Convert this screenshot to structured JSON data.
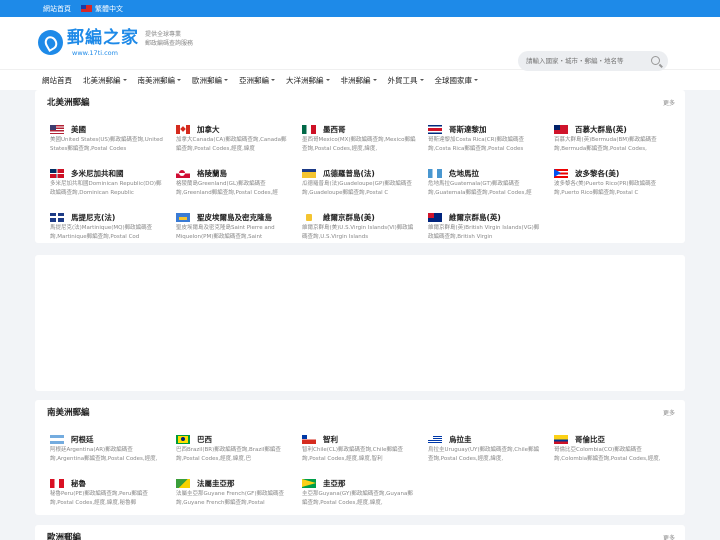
{
  "topbar": {
    "home": "網站首頁",
    "lang": "繁體中文"
  },
  "header": {
    "logo_name": "郵編之家",
    "logo_url": "www.17ti.com",
    "slogan_1": "提供全球專業",
    "slogan_2": "郵政編碼查詢服務",
    "search_placeholder": "請輸入國家・城市・郵編・地名等"
  },
  "nav": [
    "網站首頁",
    "北美洲郵編",
    "南美洲郵編",
    "歐洲郵編",
    "亞洲郵編",
    "大洋洲郵編",
    "非洲郵編",
    "外貿工具",
    "全球國家庫"
  ],
  "sections": [
    {
      "title": "北美洲郵編",
      "more": "更多",
      "items": [
        {
          "name": "美國",
          "flag": "us",
          "desc": "美國United States(US)郵政編碼查詢,United States郵編查詢,Postal Codes"
        },
        {
          "name": "加拿大",
          "flag": "ca",
          "desc": "加拿大Canada(CA)郵政編碼查詢,Canada郵編查詢,Postal Codes,經度,緯度"
        },
        {
          "name": "墨西哥",
          "flag": "mx",
          "desc": "墨西哥Mexico(MX)郵政編碼查詢,Mexico郵編查詢,Postal Codes,經度,緯度,"
        },
        {
          "name": "哥斯達黎加",
          "flag": "cr",
          "desc": "哥斯達黎加Costa Rica(CR)郵政編碼查詢,Costa Rica郵編查詢,Postal Codes"
        },
        {
          "name": "百慕大群島(英)",
          "flag": "bm",
          "desc": "百慕大群島(英)Bermuda(BM)郵政編碼查詢,Bermuda郵編查詢,Postal Codes,"
        },
        {
          "name": "多米尼加共和國",
          "flag": "do",
          "desc": "多米尼加共和國Dominican Republic(DO)郵政編碼查詢,Dominican Republic"
        },
        {
          "name": "格陵蘭島",
          "flag": "gl",
          "desc": "格陵蘭島Greenland(GL)郵政編碼查詢,Greenland郵編查詢,Postal Codes,經"
        },
        {
          "name": "瓜德羅普島(法)",
          "flag": "gp",
          "desc": "瓜德羅普島(法)Guadeloupe(GP)郵政編碼查詢,Guadeloupe郵編查詢,Postal C"
        },
        {
          "name": "危地馬拉",
          "flag": "gt",
          "desc": "危地馬拉Guatemala(GT)郵政編碼查詢,Guatemala郵編查詢,Postal Codes,經"
        },
        {
          "name": "波多黎各(美)",
          "flag": "pr",
          "desc": "波多黎各(美)Puerto Rico(PR)郵政編碼查詢,Puerto Rico郵編查詢,Postal C"
        },
        {
          "name": "馬提尼克(法)",
          "flag": "mq",
          "desc": "馬提尼克(法)Martinique(MQ)郵政編碼查詢,Martinique郵編查詢,Postal Cod"
        },
        {
          "name": "聖皮埃爾島及密克隆島",
          "flag": "pm",
          "desc": "聖皮埃爾島及密克隆島Saint Pierre and Miquelon(PM)郵政編碼查詢,Saint"
        },
        {
          "name": "維爾京群島(美)",
          "flag": "vi",
          "desc": "維爾京群島(美)U.S.Virgin Islands(VI)郵政編碼查詢,U.S.Virgin Islands"
        },
        {
          "name": "維爾京群島(英)",
          "flag": "vg",
          "desc": "維爾京群島(英)British Virgin Islands(VG)郵政編碼查詢,British Virgin"
        }
      ]
    },
    {
      "title": "南美洲郵編",
      "more": "更多",
      "items": [
        {
          "name": "阿根廷",
          "flag": "ar",
          "desc": "阿根廷Argentina(AR)郵政編碼查詢,Argentina郵編查詢,Postal Codes,經度,"
        },
        {
          "name": "巴西",
          "flag": "br",
          "desc": "巴西Brazil(BR)郵政編碼查詢,Brazil郵編查詢,Postal Codes,經度,緯度,巴"
        },
        {
          "name": "智利",
          "flag": "cl",
          "desc": "智利Chile(CL)郵政編碼查詢,Chile郵編查詢,Postal Codes,經度,緯度,智利"
        },
        {
          "name": "烏拉圭",
          "flag": "uy",
          "desc": "烏拉圭Uruguay(UY)郵政編碼查詢,Chile郵編查詢,Postal Codes,經度,緯度,"
        },
        {
          "name": "哥倫比亞",
          "flag": "co",
          "desc": "哥倫比亞Colombia(CO)郵政編碼查詢,Colombia郵編查詢,Postal Codes,經度,"
        },
        {
          "name": "秘魯",
          "flag": "pe",
          "desc": "秘魯Peru(PE)郵政編碼查詢,Peru郵編查詢,Postal Codes,經度,緯度,秘魯郵"
        },
        {
          "name": "法屬圭亞那",
          "flag": "gf",
          "desc": "法屬圭亞那Guyane French(GF)郵政編碼查詢,Guyane French郵編查詢,Postal"
        },
        {
          "name": "圭亞那",
          "flag": "gy",
          "desc": "圭亞那Guyana(GY)郵政編碼查詢,Guyana郵編查詢,Postal Codes,經度,緯度,"
        }
      ]
    },
    {
      "title": "歐洲郵編",
      "more": "更多",
      "items": []
    }
  ],
  "colors": {
    "primary": "#1e8ae8",
    "background": "#f2f4f7"
  }
}
